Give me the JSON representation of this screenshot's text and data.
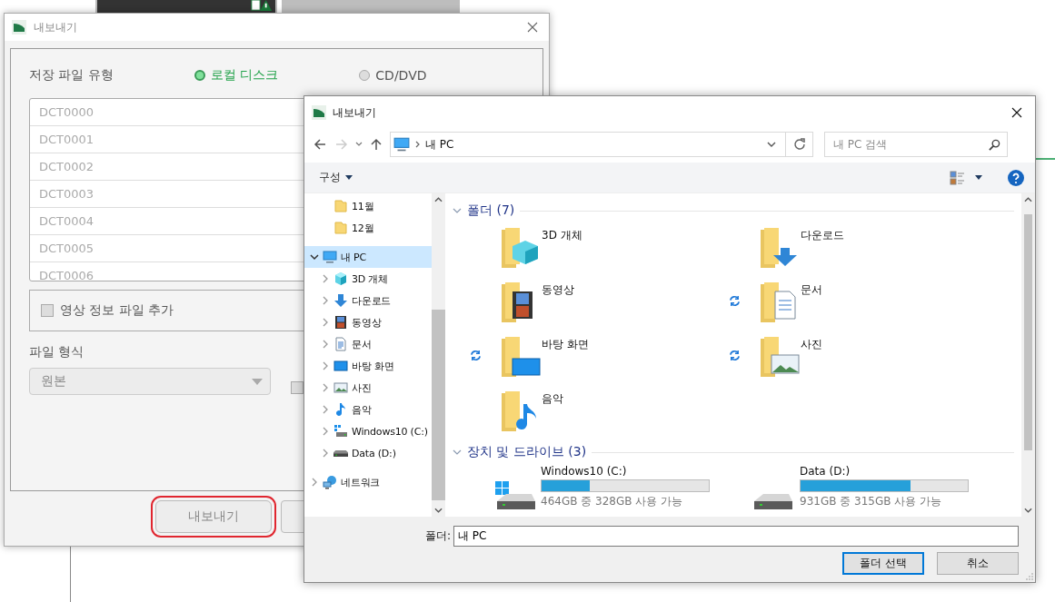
{
  "export_window": {
    "title": "내보내기",
    "storage_label": "저장 파일 유형",
    "storage_options": [
      {
        "label": "로컬 디스크",
        "selected": true
      },
      {
        "label": "CD/DVD",
        "selected": false
      }
    ],
    "files": [
      "DCT0000",
      "DCT0001",
      "DCT0002",
      "DCT0003",
      "DCT0004",
      "DCT0005",
      "DCT0006"
    ],
    "info_checkbox": {
      "label": "영상 정보 파일 추가",
      "checked": false
    },
    "format_label": "파일 형식",
    "format_dropdown": {
      "value": "원본"
    },
    "second_checkbox": {
      "checked": false
    },
    "buttons": [
      {
        "label": "내보내기",
        "highlighted": true
      },
      {
        "highlighted": false
      }
    ]
  },
  "folder_dialog": {
    "title": "내보내기",
    "address": "내 PC",
    "search": {
      "placeholder": "내 PC 검색"
    },
    "toolbar": {
      "organize": "구성"
    },
    "tree_partial": [
      {
        "label": "11월",
        "kind": "folder"
      },
      {
        "label": "12월",
        "kind": "folder"
      }
    ],
    "tree": [
      {
        "label": "내 PC",
        "kind": "pc",
        "expanded": true,
        "selected": true,
        "children": [
          {
            "label": "3D 개체",
            "kind": "cube",
            "expanded": false,
            "selected": false
          },
          {
            "label": "다운로드",
            "kind": "download",
            "expanded": false,
            "selected": false
          },
          {
            "label": "동영상",
            "kind": "film",
            "expanded": false,
            "selected": false
          },
          {
            "label": "문서",
            "kind": "document",
            "expanded": false,
            "selected": false
          },
          {
            "label": "바탕 화면",
            "kind": "desktop",
            "expanded": false,
            "selected": false
          },
          {
            "label": "사진",
            "kind": "picture",
            "expanded": false,
            "selected": false
          },
          {
            "label": "음악",
            "kind": "music",
            "expanded": false,
            "selected": false
          },
          {
            "label": "Windows10 (C:)",
            "kind": "system-drive",
            "expanded": false,
            "selected": false
          },
          {
            "label": "Data (D:)",
            "kind": "drive",
            "expanded": false,
            "selected": false
          }
        ]
      },
      {
        "label": "네트워크",
        "kind": "network",
        "expanded": false,
        "selected": false
      }
    ],
    "folders_header": "폴더 (7)",
    "folders": [
      {
        "label": "3D 개체",
        "kind": "cube",
        "syncing": false
      },
      {
        "label": "다운로드",
        "kind": "download",
        "syncing": false
      },
      {
        "label": "동영상",
        "kind": "film",
        "syncing": false
      },
      {
        "label": "문서",
        "kind": "document",
        "syncing": true
      },
      {
        "label": "바탕 화면",
        "kind": "desktop",
        "syncing": true
      },
      {
        "label": "사진",
        "kind": "picture",
        "syncing": true
      },
      {
        "label": "음악",
        "kind": "music",
        "syncing": false
      }
    ],
    "drives_header": "장치 및 드라이브 (3)",
    "drives": [
      {
        "name": "Windows10 (C:)",
        "kind": "system",
        "level": 0.29,
        "free": "464GB 중 328GB 사용 가능"
      },
      {
        "name": "Data (D:)",
        "kind": "data",
        "level": 0.66,
        "free": "931GB 중 315GB 사용 가능"
      }
    ],
    "folder_field": {
      "label": "폴더:",
      "value": "내 PC"
    },
    "buttons": [
      {
        "label": "폴더 선택",
        "default": true
      },
      {
        "label": "취소",
        "default": false
      }
    ]
  }
}
